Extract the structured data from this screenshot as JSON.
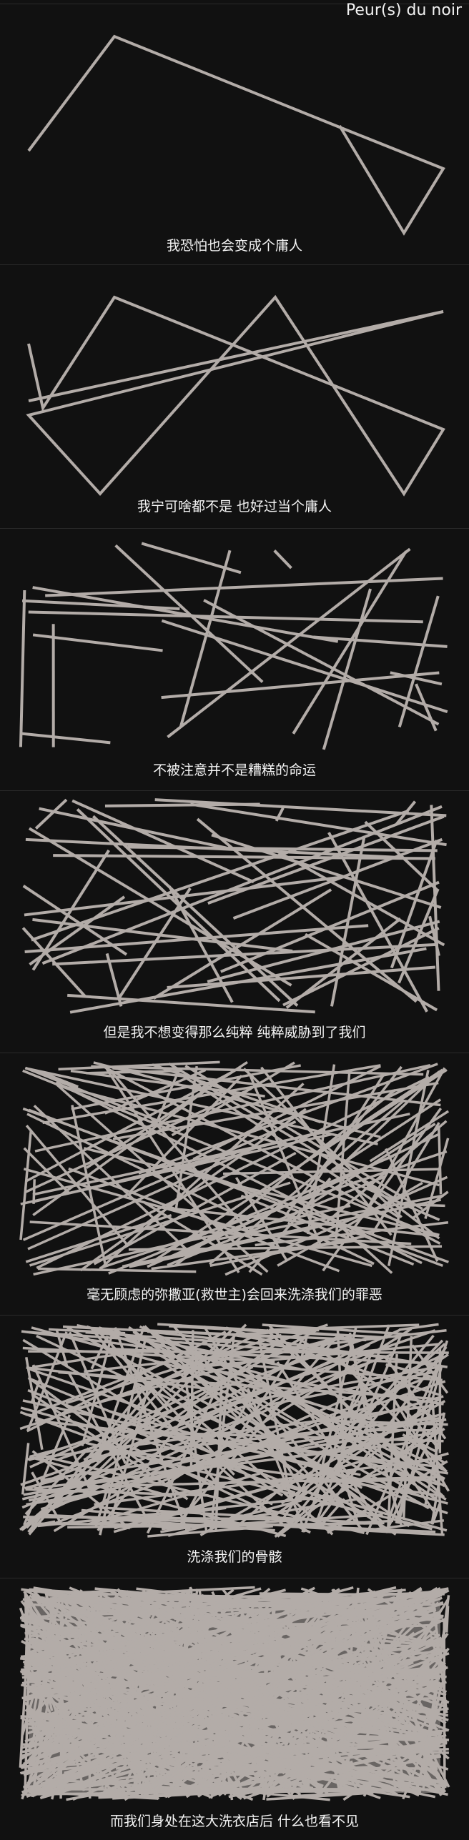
{
  "title": "Peur(s) du noir",
  "panels": [
    {
      "caption": "我恐怕也会变成个庸人",
      "density": 1
    },
    {
      "caption": "我宁可啥都不是 也好过当个庸人",
      "density": 2
    },
    {
      "caption": "不被注意并不是糟糕的命运",
      "density": 3
    },
    {
      "caption": "但是我不想变得那么纯粹 纯粹威胁到了我们",
      "density": 4
    },
    {
      "caption": "毫无顾虑的弥撒亚(救世主)会回来洗涤我们的罪恶",
      "density": 5
    },
    {
      "caption": "洗涤我们的骨骸",
      "density": 6
    },
    {
      "caption": "而我们身处在这大洗衣店后 什么也看不见",
      "density": 7
    }
  ],
  "colors": {
    "background": "#111111",
    "lines": "#b3aca8",
    "text": "#f4f4f4"
  }
}
